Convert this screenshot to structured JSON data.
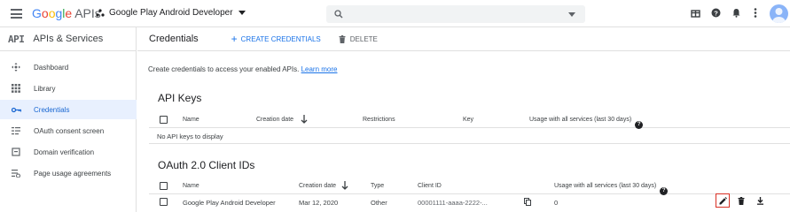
{
  "header": {
    "app_logo": "Google APIs",
    "logo_parts": [
      "G",
      "o",
      "o",
      "g",
      "l",
      "e"
    ],
    "logo_suffix": "APIs",
    "project": "Google Play Android Developer",
    "search_placeholder": "",
    "icons": [
      "gift-icon",
      "help-icon",
      "notifications-icon",
      "more-vert-icon",
      "avatar"
    ]
  },
  "sidebar": {
    "api_label": "API",
    "title": "APIs & Services",
    "items": [
      {
        "label": "Dashboard",
        "icon": "dashboard-icon"
      },
      {
        "label": "Library",
        "icon": "library-icon"
      },
      {
        "label": "Credentials",
        "icon": "key-icon",
        "active": true
      },
      {
        "label": "OAuth consent screen",
        "icon": "consent-icon"
      },
      {
        "label": "Domain verification",
        "icon": "domain-icon"
      },
      {
        "label": "Page usage agreements",
        "icon": "settings-list-icon"
      }
    ]
  },
  "main": {
    "title": "Credentials",
    "create_label": "CREATE CREDENTIALS",
    "delete_label": "DELETE",
    "description": "Create credentials to access your enabled APIs.",
    "learn_more": "Learn more",
    "api_keys": {
      "title": "API Keys",
      "columns": [
        "Name",
        "Creation date",
        "Restrictions",
        "Key",
        "Usage with all services (last 30 days)"
      ],
      "empty": "No API keys to display"
    },
    "oauth": {
      "title": "OAuth 2.0 Client IDs",
      "columns": [
        "Name",
        "Creation date",
        "Type",
        "Client ID",
        "Usage with all services (last 30 days)"
      ],
      "rows": [
        {
          "name": "Google Play Android Developer",
          "date": "Mar 12, 2020",
          "type": "Other",
          "client_id": "00001111-aaaa-2222-...",
          "usage": "0"
        }
      ]
    }
  },
  "colors": {
    "accent": "#1a73e8",
    "active_bg": "#e8f0fe",
    "highlight": "#d93025"
  }
}
